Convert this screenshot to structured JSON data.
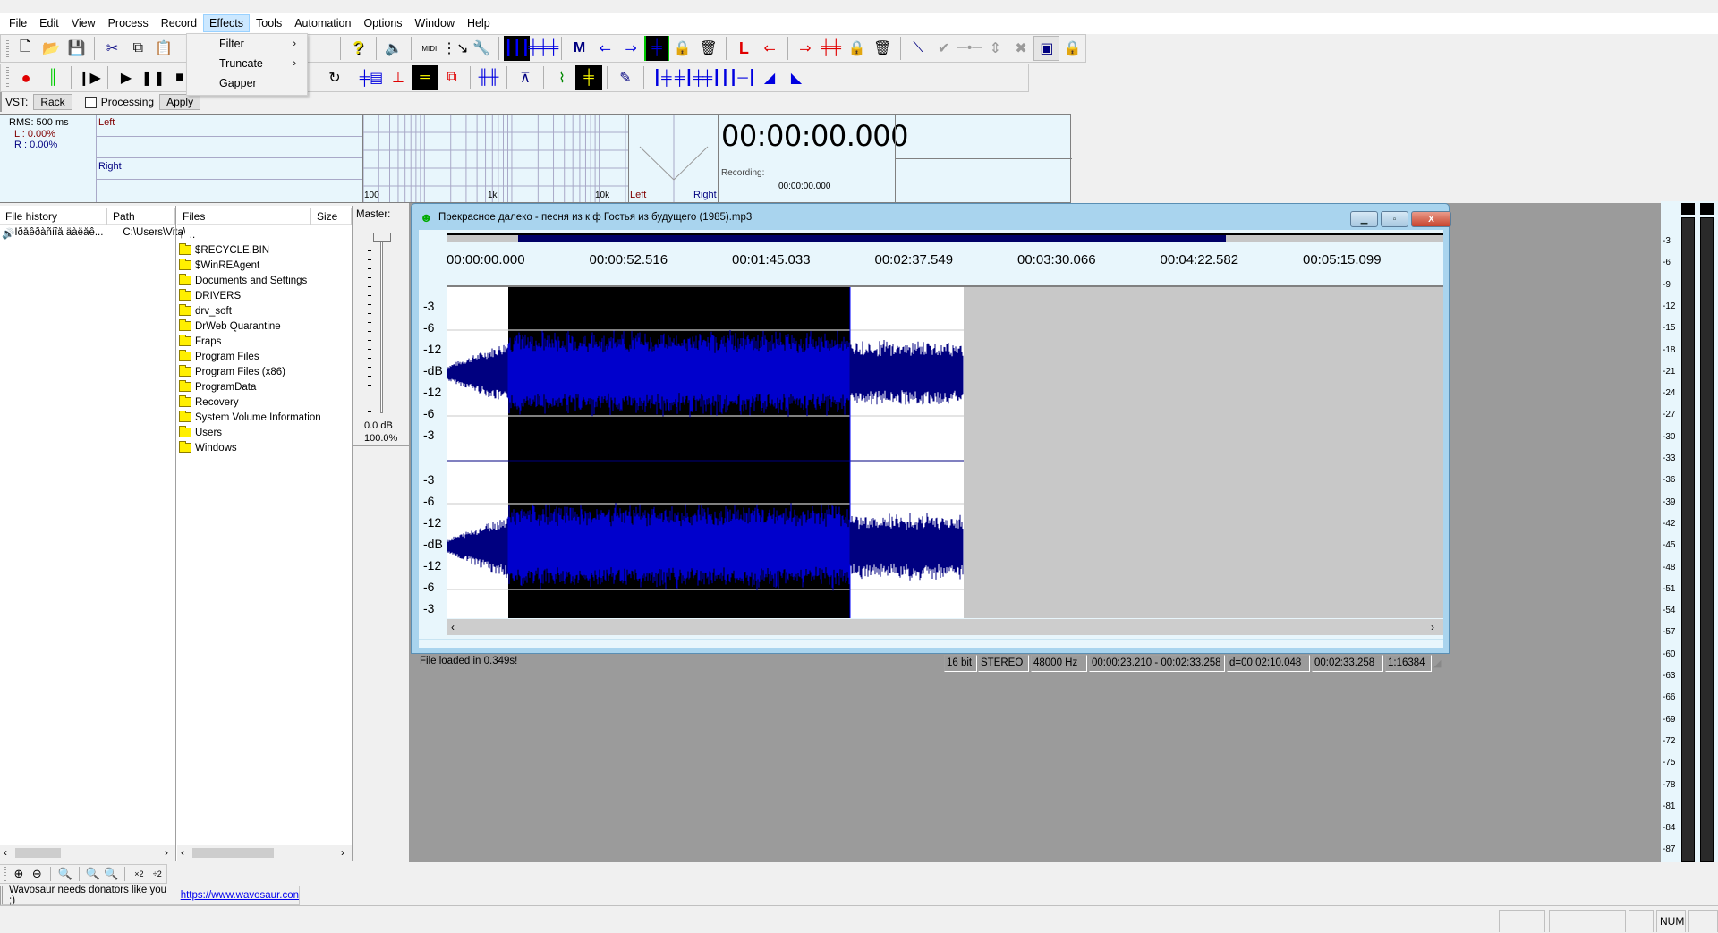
{
  "menubar": {
    "items": [
      "File",
      "Edit",
      "View",
      "Process",
      "Record",
      "Effects",
      "Tools",
      "Automation",
      "Options",
      "Window",
      "Help"
    ],
    "active": "Effects"
  },
  "effects_menu": {
    "items": [
      {
        "label": "Filter",
        "submenu": true
      },
      {
        "label": "Truncate",
        "submenu": true
      },
      {
        "label": "Gapper",
        "submenu": false
      }
    ]
  },
  "toolbar_row1": {
    "icons": [
      "new-file",
      "open-folder",
      "save-disk",
      "cut-scissors",
      "copy",
      "paste",
      "help-question",
      "speaker-volume",
      "midi",
      "routing",
      "wrench-settings",
      "waveform-multi",
      "waveform-green",
      "marker-m",
      "marker-prev",
      "marker-next",
      "marker-selection",
      "marker-lock",
      "marker-delete",
      "loop-l",
      "loop-prev",
      "loop-next",
      "loop-selection",
      "loop-lock",
      "loop-delete",
      "envelope",
      "envelope-apply",
      "envelope-point",
      "envelope-vertical",
      "envelope-cancel",
      "play-through",
      "lock"
    ]
  },
  "toolbar_row2": {
    "icons": [
      "record",
      "vu-meter",
      "play-from-start",
      "play",
      "pause",
      "stop",
      "loop-arrow",
      "waveform-doc",
      "spectrum-analyzer",
      "waveform-band",
      "copy-red",
      "waveform-split",
      "normalize",
      "eq-graph",
      "waveform-yellow",
      "pencil-draw",
      "insert-silence",
      "trim-silence",
      "split-at-cursor",
      "split-regions",
      "fade-in",
      "fade-out"
    ]
  },
  "vst_bar": {
    "vst_label": "VST:",
    "rack_button": "Rack",
    "processing_label": "Processing",
    "processing_checked": false,
    "apply_button": "Apply"
  },
  "meters": {
    "rms_label": "RMS: 500 ms",
    "l_value": "L : 0.00%",
    "r_value": "R : 0.00%",
    "left_label": "Left",
    "right_label": "Right",
    "spectrum_ticks": [
      "100",
      "1k",
      "10k"
    ],
    "phase_left": "Left",
    "phase_right": "Right",
    "time_display": "00:00:00.000",
    "recording_label": "Recording:",
    "recording_time": "00:00:00.000"
  },
  "file_history": {
    "columns": [
      "File history",
      "Path"
    ],
    "rows": [
      {
        "name": "Ïðåêðàñíîå äàëåê...",
        "path": "C:\\Users\\Vita\\"
      }
    ]
  },
  "file_browser": {
    "columns": [
      "Files",
      "Size"
    ],
    "parent": "..",
    "folders": [
      "$RECYCLE.BIN",
      "$WinREAgent",
      "Documents and Settings",
      "DRIVERS",
      "drv_soft",
      "DrWeb Quarantine",
      "Fraps",
      "Program Files",
      "Program Files (x86)",
      "ProgramData",
      "Recovery",
      "System Volume Information",
      "Users",
      "Windows"
    ]
  },
  "master": {
    "label": "Master:",
    "db": "0.0 dB",
    "percent": "100.0%",
    "level": 1.0
  },
  "wave_window": {
    "title": "Прекрасное далеко - песня из к ф Гостья из будущего (1985).mp3",
    "time_ticks": [
      "00:00:00.000",
      "00:00:52.516",
      "00:01:45.033",
      "00:02:37.549",
      "00:03:30.066",
      "00:04:22.582",
      "00:05:15.099"
    ],
    "db_ticks": [
      "-3",
      "-6",
      "-12",
      "-dB",
      "-12",
      "-6",
      "-3"
    ],
    "view_range_fraction": [
      0.072,
      0.782
    ],
    "selection_start": "00:00:23.210",
    "selection_end": "00:02:33.258",
    "status": {
      "message": "File loaded in 0.349s!",
      "bits": "16 bit",
      "channels": "STEREO",
      "rate": "48000 Hz",
      "selection": "00:00:23.210 - 00:02:33.258",
      "duration": "d=00:02:10.048",
      "cursor": "00:02:33.258",
      "zoom": "1:16384"
    },
    "colors": {
      "waveform": "#0000cc",
      "waveform_unselected": "#000080",
      "selection_bg": "#000000"
    }
  },
  "right_meter": {
    "ticks": [
      "-3",
      "-6",
      "-9",
      "-12",
      "-15",
      "-18",
      "-21",
      "-24",
      "-27",
      "-30",
      "-33",
      "-36",
      "-39",
      "-42",
      "-45",
      "-48",
      "-51",
      "-54",
      "-57",
      "-60",
      "-63",
      "-66",
      "-69",
      "-72",
      "-75",
      "-78",
      "-81",
      "-84",
      "-87"
    ]
  },
  "zoom_toolbar": {
    "icons": [
      "zoom-in",
      "zoom-out",
      "zoom-selection",
      "zoom-in-vertical",
      "zoom-out-vertical",
      "zoom-x2",
      "zoom-div2"
    ]
  },
  "donate_bar": {
    "text": "Wavosaur needs donators like you ;)",
    "link": "https://www.wavosaur.con"
  },
  "statusbar": {
    "num": "NUM"
  }
}
